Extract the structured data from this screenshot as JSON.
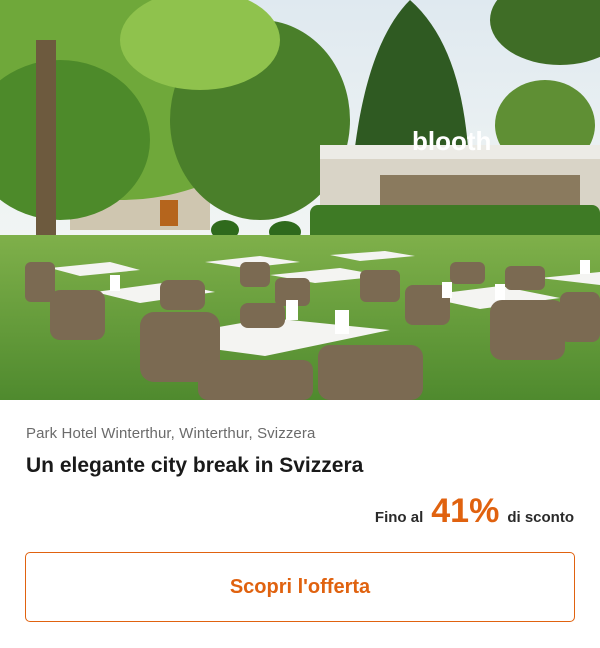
{
  "hero": {
    "sign_text": "blooth"
  },
  "offer": {
    "location": "Park Hotel Winterthur, Winterthur, Svizzera",
    "title": "Un elegante city break in Svizzera",
    "discount_prefix": "Fino al",
    "discount_value": "41%",
    "discount_suffix": "di sconto",
    "cta_label": "Scopri l'offerta"
  },
  "colors": {
    "accent": "#e0620f",
    "text_primary": "#1a1a1a",
    "text_secondary": "#6b6b6b"
  }
}
